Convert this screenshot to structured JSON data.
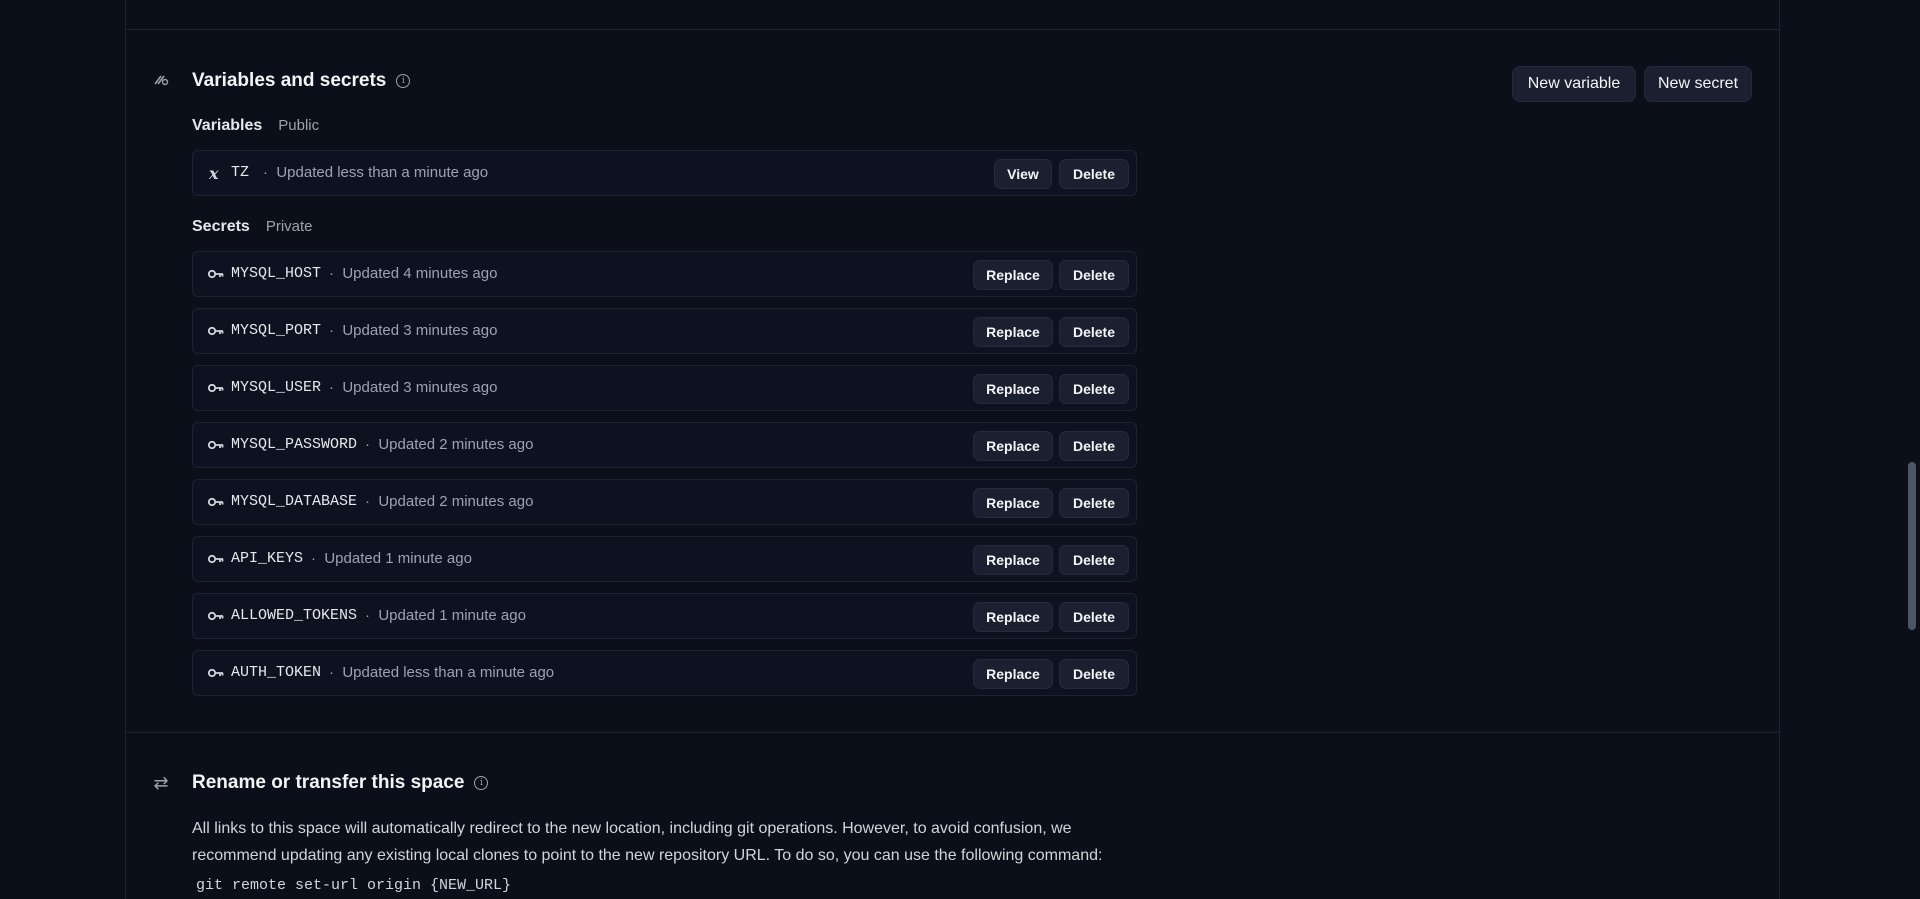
{
  "variables_section": {
    "title": "Variables and secrets",
    "new_variable_label": "New variable",
    "new_secret_label": "New secret"
  },
  "variables": {
    "label": "Variables",
    "visibility": "Public",
    "items": [
      {
        "name": "TZ",
        "updated": "Updated less than a minute ago",
        "view_label": "View",
        "delete_label": "Delete"
      }
    ]
  },
  "secrets": {
    "label": "Secrets",
    "visibility": "Private",
    "items": [
      {
        "name": "MYSQL_HOST",
        "updated": "Updated 4 minutes ago",
        "replace_label": "Replace",
        "delete_label": "Delete"
      },
      {
        "name": "MYSQL_PORT",
        "updated": "Updated 3 minutes ago",
        "replace_label": "Replace",
        "delete_label": "Delete"
      },
      {
        "name": "MYSQL_USER",
        "updated": "Updated 3 minutes ago",
        "replace_label": "Replace",
        "delete_label": "Delete"
      },
      {
        "name": "MYSQL_PASSWORD",
        "updated": "Updated 2 minutes ago",
        "replace_label": "Replace",
        "delete_label": "Delete"
      },
      {
        "name": "MYSQL_DATABASE",
        "updated": "Updated 2 minutes ago",
        "replace_label": "Replace",
        "delete_label": "Delete"
      },
      {
        "name": "API_KEYS",
        "updated": "Updated 1 minute ago",
        "replace_label": "Replace",
        "delete_label": "Delete"
      },
      {
        "name": "ALLOWED_TOKENS",
        "updated": "Updated 1 minute ago",
        "replace_label": "Replace",
        "delete_label": "Delete"
      },
      {
        "name": "AUTH_TOKEN",
        "updated": "Updated less than a minute ago",
        "replace_label": "Replace",
        "delete_label": "Delete"
      }
    ]
  },
  "rename_section": {
    "title": "Rename or transfer this space",
    "description_line1": "All links to this space will automatically redirect to the new location, including git operations. However, to avoid confusion, we",
    "description_line2": "recommend updating any existing local clones to point to the new repository URL. To do so, you can use the following command:",
    "command": "git remote set-url origin {NEW_URL}"
  },
  "separator": "·",
  "colors": {
    "background": "#0b0f19",
    "button_bg": "#1a2030",
    "muted_text": "#9ca3af"
  }
}
